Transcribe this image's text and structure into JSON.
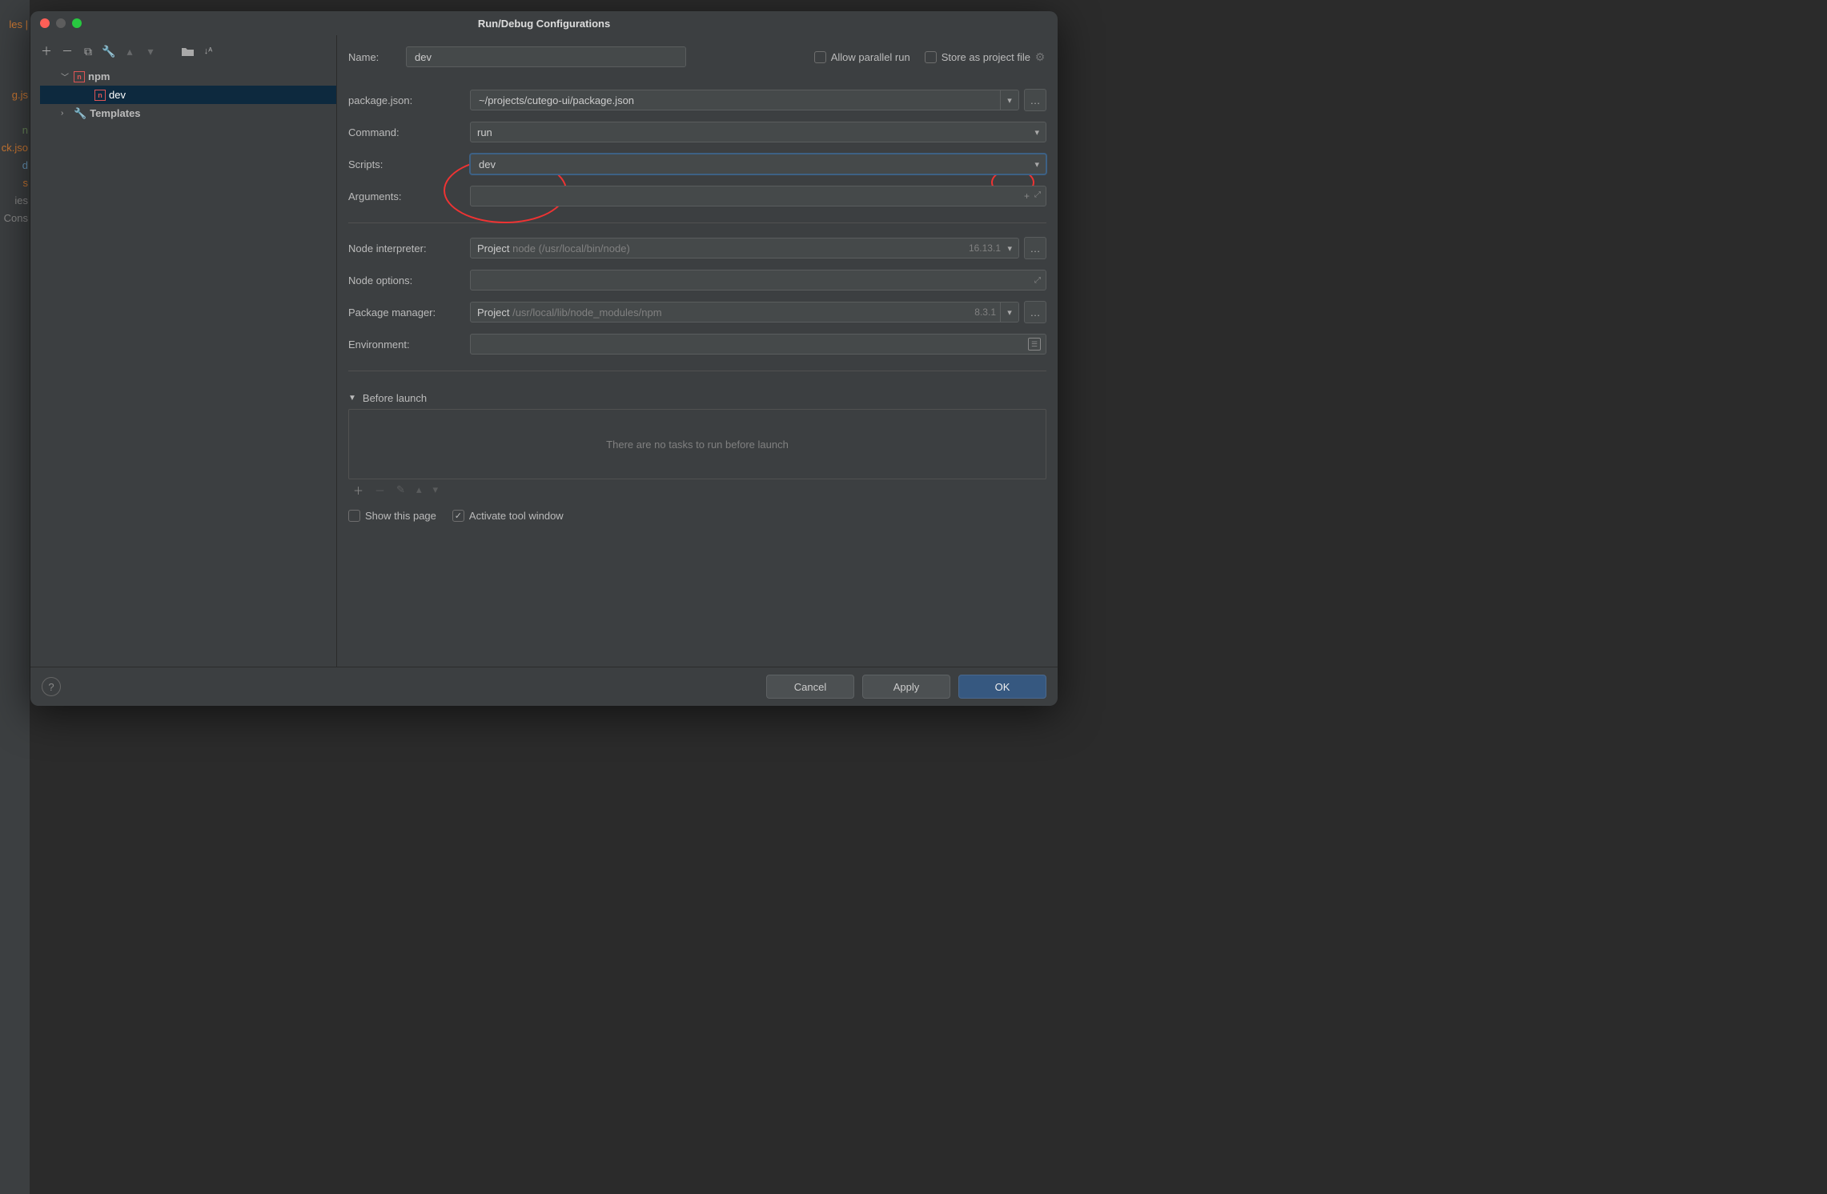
{
  "bg_items": [
    "les |",
    "",
    "",
    "",
    "g.js",
    "",
    "n",
    "ck.jso",
    "d",
    "s",
    "ies",
    "Cons"
  ],
  "dialog": {
    "title": "Run/Debug Configurations"
  },
  "tree": {
    "npm_label": "npm",
    "dev_label": "dev",
    "templates_label": "Templates"
  },
  "top": {
    "name_label": "Name:",
    "name_value": "dev",
    "parallel_label": "Allow parallel run",
    "store_label": "Store as project file"
  },
  "fields": {
    "package_label": "package.json:",
    "package_value": "~/projects/cutego-ui/package.json",
    "command_label": "Command:",
    "command_value": "run",
    "scripts_label": "Scripts:",
    "scripts_value": "dev",
    "arguments_label": "Arguments:",
    "arguments_value": "",
    "node_interp_label": "Node interpreter:",
    "node_interp_prefix": "Project",
    "node_interp_hint": "node (/usr/local/bin/node)",
    "node_interp_version": "16.13.1",
    "node_options_label": "Node options:",
    "pkg_mgr_label": "Package manager:",
    "pkg_mgr_prefix": "Project",
    "pkg_mgr_hint": "/usr/local/lib/node_modules/npm",
    "pkg_mgr_version": "8.3.1",
    "env_label": "Environment:"
  },
  "before": {
    "header": "Before launch",
    "empty": "There are no tasks to run before launch",
    "show_page": "Show this page",
    "activate": "Activate tool window"
  },
  "footer": {
    "cancel": "Cancel",
    "apply": "Apply",
    "ok": "OK"
  }
}
